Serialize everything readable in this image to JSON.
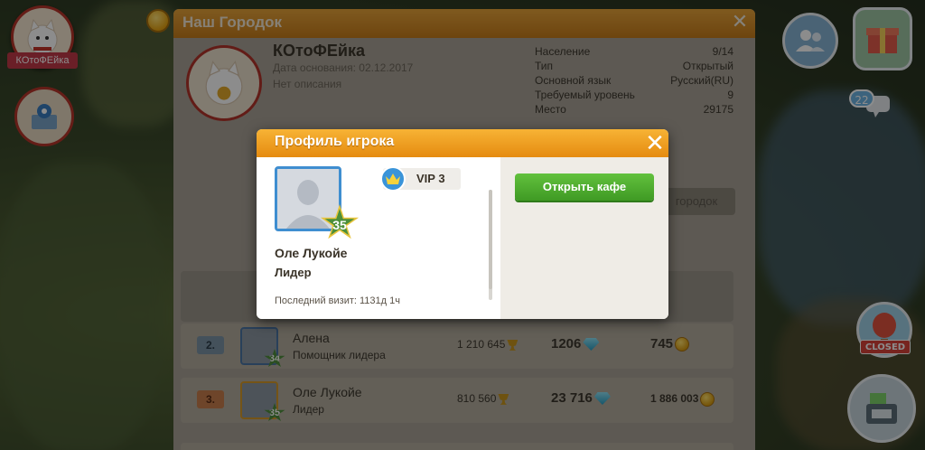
{
  "player_tag": "КОтоФЕйка",
  "chat": {
    "count": "22"
  },
  "closed_label": "CLOSED",
  "town_window": {
    "title": "Наш Городок",
    "close": "✕",
    "name": "КОтоФЕйка",
    "founded": "Дата основания: 02.12.2017",
    "description": "Нет описания",
    "stats": [
      {
        "label": "Население",
        "value": "9/14"
      },
      {
        "label": "Тип",
        "value": "Открытый"
      },
      {
        "label": "Основной язык",
        "value": "Русский(RU)"
      },
      {
        "label": "Требуемый уровень",
        "value": "9"
      },
      {
        "label": "Место",
        "value": "29175"
      }
    ],
    "action_button": "городок",
    "members": [
      {
        "rank": "2.",
        "level": "34",
        "name": "Алена",
        "role": "Помощник лидера",
        "trophies": "1 210 645",
        "gems": "1206",
        "coins": "745"
      },
      {
        "rank": "3.",
        "level": "35",
        "name": "Оле Лукойе",
        "role": "Лидер",
        "trophies": "810 560",
        "gems": "23 716",
        "coins": "1 886 003"
      }
    ]
  },
  "profile_dialog": {
    "title": "Профиль игрока",
    "close": "✕",
    "level": "35",
    "name": "Оле Лукойе",
    "role": "Лидер",
    "last_visit": "Последний визит: 1131д 1ч",
    "vip": "VIP 3",
    "open_cafe_button": "Открыть кафе"
  },
  "colors": {
    "header_orange": "#e58b10",
    "button_green": "#3f9a24",
    "avatar_border_blue": "#3f8ed0"
  }
}
